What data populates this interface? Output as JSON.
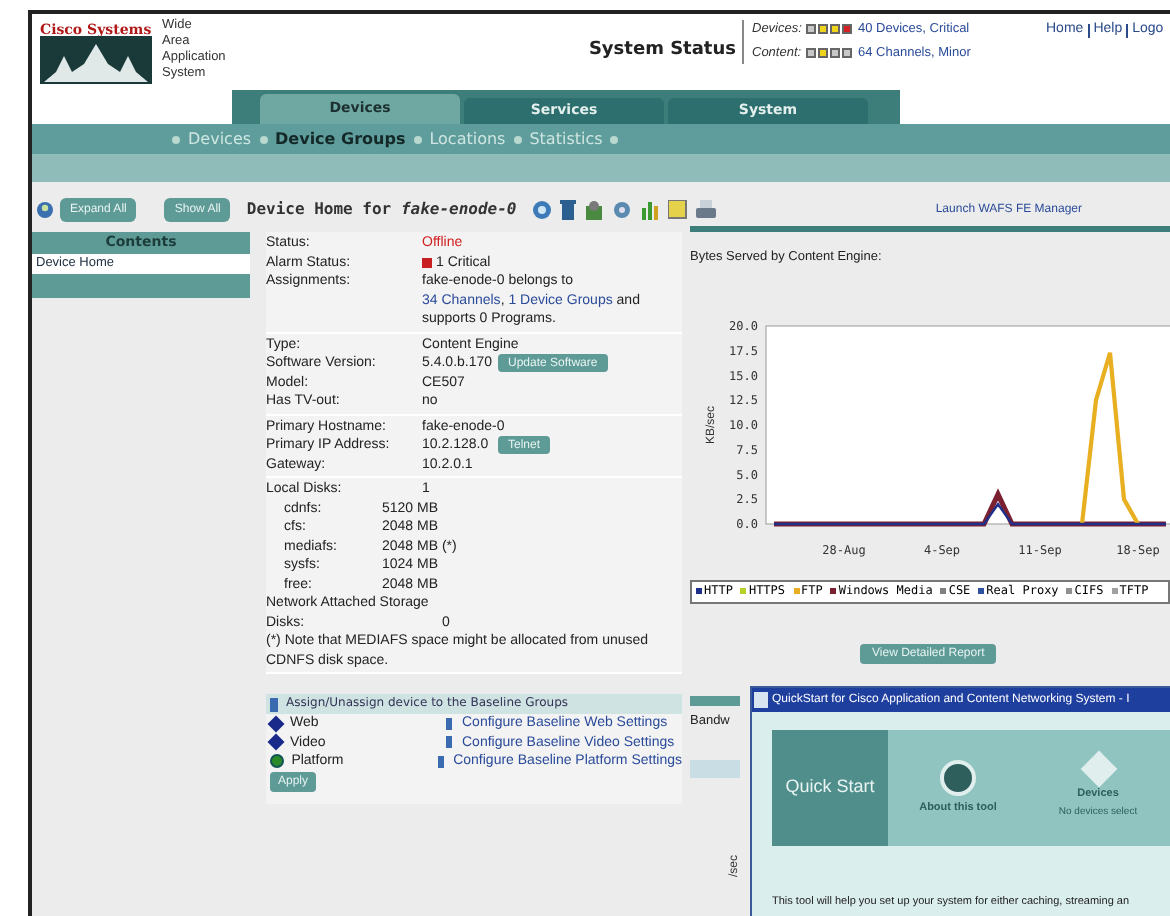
{
  "header": {
    "logo_text": "Cisco Systems",
    "product_lines": [
      "Wide",
      "Area",
      "Application",
      "System"
    ],
    "status_title": "System Status",
    "statuses": [
      {
        "label": "Devices:",
        "indicators": [
          {
            "color": "#c8c8c8"
          },
          {
            "color": "#f2d31b"
          },
          {
            "color": "#f2d31b"
          },
          {
            "color": "#d42020"
          }
        ],
        "link": "40 Devices, Critical"
      },
      {
        "label": "Content:",
        "indicators": [
          {
            "color": "#c8c8c8"
          },
          {
            "color": "#f2d31b"
          },
          {
            "color": "#c8c8c8"
          },
          {
            "color": "#c8c8c8"
          }
        ],
        "link": "64 Channels, Minor"
      }
    ],
    "top_links": [
      "Home",
      "Help",
      "Logo"
    ]
  },
  "tabs": [
    {
      "label": "Devices",
      "selected": true
    },
    {
      "label": "Services",
      "selected": false
    },
    {
      "label": "System",
      "selected": false
    }
  ],
  "subnav": [
    {
      "label": "Devices",
      "selected": false
    },
    {
      "label": "Device Groups",
      "selected": true
    },
    {
      "label": "Locations",
      "selected": false
    },
    {
      "label": "Statistics",
      "selected": false
    }
  ],
  "sidebar": {
    "expand_button": "Expand All",
    "show_button": "Show All",
    "heading": "Contents",
    "items": [
      {
        "label": "Device Home",
        "selected": true
      }
    ]
  },
  "toolbar": {
    "title": "Device Home for *fake-enode-0*",
    "launch_link": "Launch WAFS FE Manager"
  },
  "details": {
    "groups": [
      {
        "rows": [
          {
            "kind": "status",
            "label": "Status:",
            "value": "Offline"
          },
          {
            "kind": "alarm",
            "label": "Alarm Status:",
            "value": "1 Critical"
          },
          {
            "kind": "segments",
            "label": "Assignments:",
            "segments": [
              {
                "text": "fake-enode-0 belongs to",
                "kind": "text"
              },
              {
                "text": "34 Channels",
                "kind": "link"
              },
              {
                "text": ", ",
                "kind": "text"
              },
              {
                "text": "1 Device Groups",
                "kind": "link"
              },
              {
                "text": " and supports 0 Programs.",
                "kind": "text"
              }
            ]
          }
        ]
      },
      {
        "rows": [
          {
            "kind": "text",
            "label": "Type:",
            "value": "Content Engine"
          },
          {
            "kind": "button",
            "label": "Software Version:",
            "value": "5.4.0.b.170",
            "button": "Update Software"
          },
          {
            "kind": "text",
            "label": "Model:",
            "value": "CE507"
          },
          {
            "kind": "text",
            "label": "Has TV-out:",
            "value": "no"
          }
        ]
      },
      {
        "rows": [
          {
            "kind": "text",
            "label": "Primary Hostname:",
            "value": "fake-enode-0"
          },
          {
            "kind": "button",
            "label": "Primary IP Address:",
            "value": "10.2.128.0",
            "button": "Telnet"
          },
          {
            "kind": "text",
            "label": "Gateway:",
            "value": "10.2.0.1"
          }
        ]
      },
      {
        "rows": [
          {
            "kind": "text",
            "label": "Local Disks:",
            "value": "1"
          },
          {
            "kind": "sub",
            "label": "cdnfs:",
            "value": "5120 MB"
          },
          {
            "kind": "sub",
            "label": "cfs:",
            "value": "2048 MB"
          },
          {
            "kind": "sub",
            "label": "mediafs:",
            "value": "2048 MB (*)"
          },
          {
            "kind": "sub",
            "label": "sysfs:",
            "value": "1024 MB"
          },
          {
            "kind": "sub",
            "label": "free:",
            "value": "2048 MB"
          },
          {
            "kind": "text",
            "label": "Network Attached Storage Disks:",
            "value": "0"
          },
          {
            "kind": "note",
            "value": "(*) Note that MEDIAFS space might be allocated from unused CDNFS disk space."
          }
        ]
      }
    ]
  },
  "baseline": {
    "heading": "Assign/Unassign device to the Baseline Groups",
    "groups": [
      {
        "name": "Web",
        "assigned": false,
        "link": "Configure Baseline Web Settings"
      },
      {
        "name": "Video",
        "assigned": false,
        "link": "Configure Baseline Video Settings"
      },
      {
        "name": "Platform",
        "assigned": true,
        "link": "Configure Baseline Platform Settings"
      }
    ],
    "apply_button": "Apply"
  },
  "chart_panel": {
    "title": "Bytes Served by Content Engine:",
    "chart_data": {
      "type": "line",
      "ylabel": "KB/sec",
      "ylim": [
        0,
        20
      ],
      "categories": [
        null,
        null,
        null,
        null,
        null,
        "28-Aug",
        null,
        null,
        null,
        null,
        null,
        null,
        "4-Sep",
        null,
        null,
        null,
        null,
        null,
        null,
        "11-Sep",
        null,
        null,
        null,
        null,
        null,
        null,
        "18-Sep",
        null,
        null
      ],
      "yticks": [
        {
          "value": 0,
          "label": "0.0"
        },
        {
          "value": 2.5,
          "label": "2.5"
        },
        {
          "value": 5,
          "label": "5.0"
        },
        {
          "value": 7.5,
          "label": "7.5"
        },
        {
          "value": 10,
          "label": "10.0"
        },
        {
          "value": 12.5,
          "label": "12.5"
        },
        {
          "value": 15,
          "label": "15.0"
        },
        {
          "value": 17.5,
          "label": "17.5"
        },
        {
          "value": 20,
          "label": "20.0"
        }
      ],
      "series": [
        {
          "name": "HTTP",
          "color": "#1f2f8a",
          "values": [
            0,
            0,
            0,
            0,
            0,
            0,
            0,
            0,
            0,
            0,
            0,
            0,
            0,
            0,
            0,
            0,
            2,
            0,
            0,
            0,
            0,
            0,
            0,
            0,
            0,
            0,
            0,
            0,
            0
          ]
        },
        {
          "name": "HTTPS",
          "color": "#b8d028",
          "values": [
            null,
            null,
            null,
            null,
            null,
            null,
            null,
            null,
            null,
            null,
            null,
            null,
            null,
            null,
            null,
            null,
            null,
            null,
            null,
            null,
            null,
            null,
            null,
            null,
            null,
            null,
            null,
            null,
            null
          ]
        },
        {
          "name": "FTP",
          "color": "#e8b020",
          "values": [
            null,
            null,
            null,
            null,
            null,
            null,
            null,
            null,
            null,
            null,
            null,
            null,
            null,
            null,
            null,
            null,
            null,
            null,
            null,
            null,
            null,
            null,
            0,
            12.5,
            17.3,
            2.5,
            0,
            null,
            null
          ]
        },
        {
          "name": "Windows Media",
          "color": "#7a2030",
          "values": [
            0,
            0,
            0,
            0,
            0,
            0,
            0,
            0,
            0,
            0,
            0,
            0,
            0,
            0,
            0,
            0,
            3,
            0,
            0,
            0,
            0,
            0,
            0,
            0,
            0,
            0,
            0,
            0,
            0
          ]
        },
        {
          "name": "CSE",
          "color": "#808080",
          "values": [
            null,
            null,
            null,
            null,
            null,
            null,
            null,
            null,
            null,
            null,
            null,
            null,
            null,
            null,
            null,
            null,
            null,
            null,
            null,
            null,
            null,
            null,
            null,
            null,
            null,
            null,
            null,
            null,
            null
          ]
        },
        {
          "name": "Real Proxy",
          "color": "#3050a0",
          "values": [
            null,
            null,
            null,
            null,
            null,
            null,
            null,
            null,
            null,
            null,
            null,
            null,
            null,
            null,
            null,
            null,
            null,
            null,
            null,
            null,
            null,
            null,
            null,
            null,
            null,
            null,
            null,
            null,
            null
          ]
        },
        {
          "name": "CIFS",
          "color": "#909090",
          "values": [
            null,
            null,
            null,
            null,
            null,
            null,
            null,
            null,
            null,
            null,
            null,
            null,
            null,
            null,
            null,
            null,
            null,
            null,
            null,
            null,
            null,
            null,
            null,
            null,
            null,
            null,
            null,
            null,
            null
          ]
        },
        {
          "name": "TFTP",
          "color": "#a0a0a0",
          "values": [
            null,
            null,
            null,
            null,
            null,
            null,
            null,
            null,
            null,
            null,
            null,
            null,
            null,
            null,
            null,
            null,
            null,
            null,
            null,
            null,
            null,
            null,
            null,
            null,
            null,
            null,
            null,
            null,
            null
          ]
        }
      ]
    },
    "report_button": "View Detailed Report",
    "next_section": "Bandw",
    "next_axis_label": "/sec"
  },
  "quickstart": {
    "title": "QuickStart for Cisco Application and Content Networking System - I",
    "heading": "Quick Start",
    "steps": [
      {
        "label": "About this tool"
      },
      {
        "label": "Devices",
        "sublabel": "No devices select"
      }
    ],
    "body": "This tool will help you set up your system for either caching, streaming an"
  }
}
